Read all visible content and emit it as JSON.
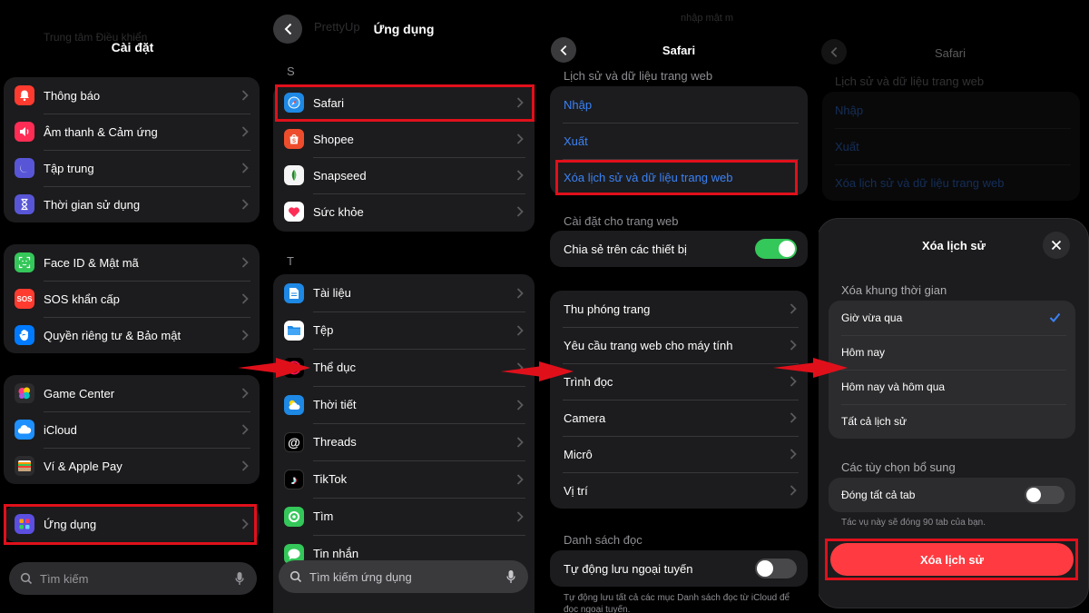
{
  "panel1": {
    "faded_top": [
      "Trung tâm Điều khiển"
    ],
    "title": "Cài đặt",
    "group1": [
      {
        "label": "Thông báo",
        "icon": "bell-icon",
        "color": "#ff3b30"
      },
      {
        "label": "Âm thanh & Cảm ứng",
        "icon": "speaker-icon",
        "color": "#ff2d55"
      },
      {
        "label": "Tập trung",
        "icon": "moon-icon",
        "color": "#5856d6"
      },
      {
        "label": "Thời gian sử dụng",
        "icon": "hourglass-icon",
        "color": "#5856d6"
      }
    ],
    "group2": [
      {
        "label": "Face ID & Mật mã",
        "icon": "faceid-icon",
        "color": "#34c759"
      },
      {
        "label": "SOS khẩn cấp",
        "icon": "sos-icon",
        "color": "#ff3b30",
        "glyph": "SOS"
      },
      {
        "label": "Quyền riêng tư & Bảo mật",
        "icon": "hand-icon",
        "color": "#007aff"
      }
    ],
    "group3": [
      {
        "label": "Game Center",
        "icon": "game-center-icon",
        "color": "#8e44ad"
      },
      {
        "label": "iCloud",
        "icon": "cloud-icon",
        "color": "#1e90ff"
      },
      {
        "label": "Ví & Apple Pay",
        "icon": "wallet-icon",
        "color": "#2c2c2e"
      }
    ],
    "apps_item": {
      "label": "Ứng dụng",
      "icon": "apps-grid-icon",
      "color": "#5b4ee0"
    },
    "search_placeholder": "Tìm kiếm"
  },
  "panel2": {
    "faded_top": "PrettyUp",
    "title": "Ứng dụng",
    "section_s": "S",
    "s_items": [
      {
        "label": "Safari",
        "icon": "safari-icon",
        "color": "#1e88e5"
      },
      {
        "label": "Shopee",
        "icon": "shopee-icon",
        "color": "#ee4d2d"
      },
      {
        "label": "Snapseed",
        "icon": "snapseed-icon",
        "color": "#2e7d32"
      },
      {
        "label": "Sức khỏe",
        "icon": "heart-icon",
        "color": "#ffffff"
      }
    ],
    "section_t": "T",
    "t_items": [
      {
        "label": "Tài liệu",
        "icon": "document-icon",
        "color": "#1e88e5"
      },
      {
        "label": "Tệp",
        "icon": "folder-icon",
        "color": "#1e88e5"
      },
      {
        "label": "Thể dục",
        "icon": "fitness-icon",
        "color": "#1c1c1e"
      },
      {
        "label": "Thời tiết",
        "icon": "weather-icon",
        "color": "#1e88e5"
      },
      {
        "label": "Threads",
        "icon": "threads-icon",
        "color": "#000000",
        "glyph": "@"
      },
      {
        "label": "TikTok",
        "icon": "tiktok-icon",
        "color": "#000000",
        "glyph": "♪"
      },
      {
        "label": "Tìm",
        "icon": "find-my-icon",
        "color": "#34c759"
      },
      {
        "label": "Tin nhắn",
        "icon": "messages-icon",
        "color": "#34c759"
      }
    ],
    "search_placeholder": "Tìm kiếm ứng dụng"
  },
  "panel3": {
    "faded_top": "nhập mật m",
    "title": "Safari",
    "section_history": "Lịch sử và dữ liệu trang web",
    "history_items": [
      "Nhập",
      "Xuất",
      "Xóa lịch sử và dữ liệu trang web"
    ],
    "section_web": "Cài đặt cho trang web",
    "share_label": "Chia sẻ trên các thiết bị",
    "share_on": true,
    "web_items": [
      "Thu phóng trang",
      "Yêu cầu trang web cho máy tính",
      "Trình đọc",
      "Camera",
      "Micrô",
      "Vị trí"
    ],
    "section_reading": "Danh sách đọc",
    "offline_label": "Tự động lưu ngoại tuyến",
    "offline_on": false,
    "offline_note": "Tự động lưu tất cả các mục Danh sách đọc từ iCloud để đọc ngoại tuyến."
  },
  "panel4": {
    "title": "Safari",
    "section_history": "Lịch sử và dữ liệu trang web",
    "history_items": [
      "Nhập",
      "Xuất",
      "Xóa lịch sử và dữ liệu trang web"
    ],
    "sheet": {
      "title": "Xóa lịch sử",
      "timeframe_label": "Xóa khung thời gian",
      "options": [
        "Giờ vừa qua",
        "Hôm nay",
        "Hôm nay và hôm qua",
        "Tất cả lịch sử"
      ],
      "selected": "Giờ vừa qua",
      "extra_label": "Các tùy chọn bổ sung",
      "close_tabs_label": "Đóng tất cả tab",
      "close_tabs_on": false,
      "close_tabs_note": "Tác vụ này sẽ đóng 90 tab của bạn.",
      "action_button": "Xóa lịch sử"
    }
  },
  "colors": {
    "highlight": "#e0101b",
    "accent_blue": "#3b82f6",
    "danger": "#ff3b41"
  }
}
